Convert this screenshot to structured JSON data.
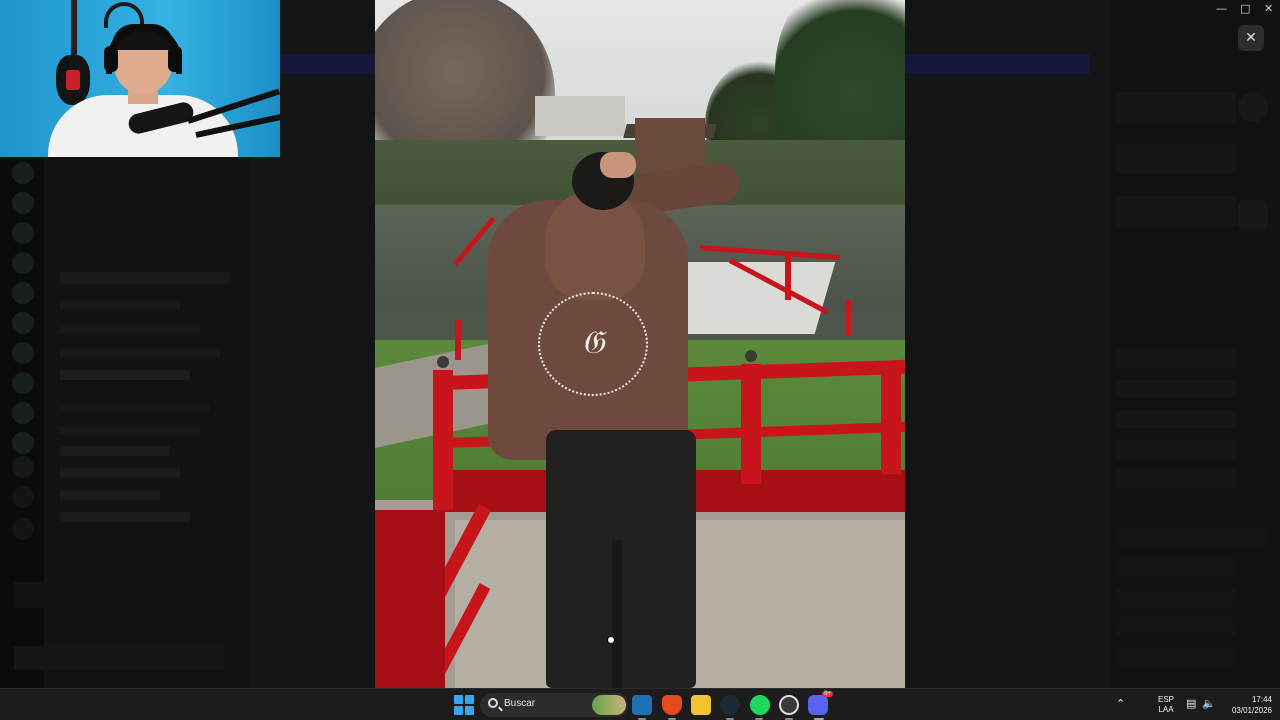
{
  "viewer": {
    "close_icon": "close-icon",
    "photo_alt": "image-preview"
  },
  "taskbar": {
    "search_placeholder": "Buscar",
    "lang_line1": "ESP",
    "lang_line2": "LAA",
    "time": "17:44",
    "date": "03/01/2026",
    "apps": [
      "windows-start-icon",
      "search-icon",
      "store-icon",
      "brave-browser-icon",
      "file-explorer-icon",
      "steam-icon",
      "spotify-icon",
      "steamvr-icon",
      "discord-icon"
    ],
    "discord_badge": "9+"
  },
  "window_controls": [
    "minimize-icon",
    "maximize-icon",
    "close-icon"
  ],
  "colors": {
    "discord_blurple": "#5865F2",
    "rail_red": "#C8141B",
    "taskbar_bg": "#1C1C1C"
  }
}
